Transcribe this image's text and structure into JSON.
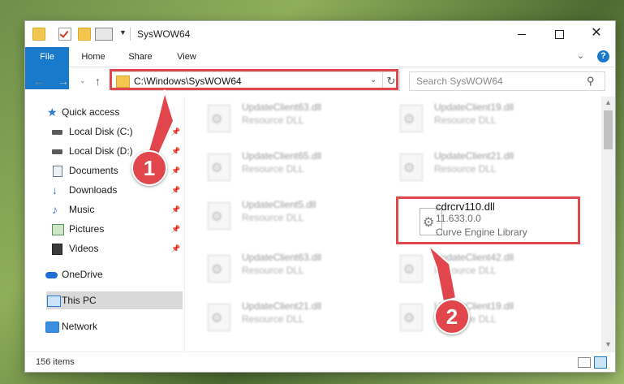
{
  "window": {
    "title": "SysWOW64",
    "minimize_glyph": "",
    "close_glyph": "✕"
  },
  "ribbon": {
    "tabs": [
      "File",
      "Home",
      "Share",
      "View"
    ],
    "help_glyph": "?"
  },
  "address": {
    "path": "C:\\Windows\\SysWOW64",
    "search_placeholder": "Search SysWOW64"
  },
  "sidebar": {
    "items": [
      {
        "label": "Quick access",
        "icon": "star-icon",
        "pinned": false
      },
      {
        "label": "Local Disk (C:)",
        "icon": "drive-icon",
        "pinned": true
      },
      {
        "label": "Local Disk (D:)",
        "icon": "drive-icon",
        "pinned": true
      },
      {
        "label": "Documents",
        "icon": "document-icon",
        "pinned": true
      },
      {
        "label": "Downloads",
        "icon": "download-icon",
        "pinned": true
      },
      {
        "label": "Music",
        "icon": "music-icon",
        "pinned": true
      },
      {
        "label": "Pictures",
        "icon": "picture-icon",
        "pinned": true
      },
      {
        "label": "Videos",
        "icon": "video-icon",
        "pinned": true
      },
      {
        "label": "OneDrive",
        "icon": "cloud-icon",
        "pinned": false
      },
      {
        "label": "This PC",
        "icon": "computer-icon",
        "pinned": false,
        "selected": true
      },
      {
        "label": "Network",
        "icon": "network-icon",
        "pinned": false
      }
    ]
  },
  "files": [
    {
      "name": "UpdateClient63.dll",
      "desc": "Resource DLL"
    },
    {
      "name": "UpdateClient19.dll",
      "desc": "Resource DLL"
    },
    {
      "name": "UpdateClient65.dll",
      "desc": "Resource DLL"
    },
    {
      "name": "UpdateClient21.dll",
      "desc": "Resource DLL"
    },
    {
      "name": "UpdateClient5.dll",
      "desc": "Resource DLL"
    },
    {
      "name": "cdrcrv110.dll",
      "desc": "11.633.0.0",
      "desc2": "Curve Engine Library"
    },
    {
      "name": "UpdateClient63.dll",
      "desc": "Resource DLL"
    },
    {
      "name": "UpdateClient42.dll",
      "desc": "Resource DLL"
    },
    {
      "name": "UpdateClient21.dll",
      "desc": "Resource DLL"
    },
    {
      "name": "UpdateClient19.dll",
      "desc": "Resource DLL"
    }
  ],
  "status": {
    "item_count": "156 items"
  },
  "annotations": {
    "callout_1": "1",
    "callout_2": "2",
    "accent_color": "#e0464b"
  }
}
